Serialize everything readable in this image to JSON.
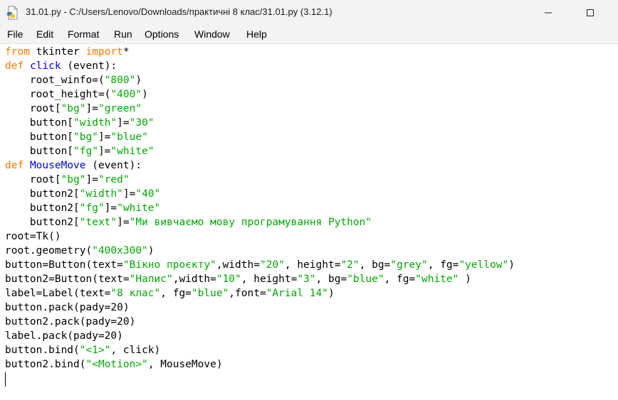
{
  "window": {
    "title": "31.01.py - C:/Users/Lenovo/Downloads/практичні 8 клас/31.01.py (3.12.1)"
  },
  "menu": [
    {
      "label": "File"
    },
    {
      "label": "Edit"
    },
    {
      "label": "Format"
    },
    {
      "label": "Run"
    },
    {
      "label": "Options"
    },
    {
      "label": "Window"
    },
    {
      "label": "Help"
    }
  ],
  "code": {
    "l1": {
      "a": "from",
      "b": " tkinter ",
      "c": "import",
      "d": "*"
    },
    "l2": {
      "a": "def",
      "b": " ",
      "c": "click",
      "d": " (event):"
    },
    "l3": {
      "a": "    root_winfo=(",
      "b": "\"800\"",
      "c": ")"
    },
    "l4": {
      "a": "    root_height=(",
      "b": "\"400\"",
      "c": ")"
    },
    "l5": {
      "a": "    root[",
      "b": "\"bg\"",
      "c": "]=",
      "d": "\"green\""
    },
    "l6": {
      "a": "    button[",
      "b": "\"width\"",
      "c": "]=",
      "d": "\"30\""
    },
    "l7": {
      "a": "    button[",
      "b": "\"bg\"",
      "c": "]=",
      "d": "\"blue\""
    },
    "l8": {
      "a": "    button[",
      "b": "\"fg\"",
      "c": "]=",
      "d": "\"white\""
    },
    "l9": {
      "a": "def",
      "b": " ",
      "c": "MouseMove",
      "d": " (event):"
    },
    "l10": {
      "a": "    root[",
      "b": "\"bg\"",
      "c": "]=",
      "d": "\"red\""
    },
    "l11": {
      "a": "    button2[",
      "b": "\"width\"",
      "c": "]=",
      "d": "\"40\""
    },
    "l12": {
      "a": "    button2[",
      "b": "\"fg\"",
      "c": "]=",
      "d": "\"white\""
    },
    "l13": {
      "a": "    button2[",
      "b": "\"text\"",
      "c": "]=",
      "d": "\"Ми вивчаємо мову програмування Python\""
    },
    "l14": {
      "a": "root=Tk()"
    },
    "l15": {
      "a": "root.geometry(",
      "b": "\"400x300\"",
      "c": ")"
    },
    "l16": {
      "a": "button=Button(text=",
      "b": "\"Вікно проєкту\"",
      "c": ",width=",
      "d": "\"20\"",
      "e": ", height=",
      "f": "\"2\"",
      "g": ", bg=",
      "h": "\"grey\"",
      "i": ", fg=",
      "j": "\"yellow\"",
      "k": ")"
    },
    "l17": {
      "a": "button2=Button(text=",
      "b": "\"Напис\"",
      "c": ",width=",
      "d": "\"10\"",
      "e": ", height=",
      "f": "\"3\"",
      "g": ", bg=",
      "h": "\"blue\"",
      "i": ", fg=",
      "j": "\"white\"",
      "k": " )"
    },
    "l18": {
      "a": "label=Label(text=",
      "b": "\"8 клас\"",
      "c": ", fg=",
      "d": "\"blue\"",
      "e": ",font=",
      "f": "\"Arial 14\"",
      "g": ")"
    },
    "l19": {
      "a": "button.pack(pady=20)"
    },
    "l20": {
      "a": "button2.pack(pady=20)"
    },
    "l21": {
      "a": "label.pack(pady=20)"
    },
    "l22": {
      "a": "button.bind(",
      "b": "\"<1>\"",
      "c": ", click)"
    },
    "l23": {
      "a": "button2.bind(",
      "b": "\"<Motion>\"",
      "c": ", MouseMove)"
    }
  },
  "colors": {
    "keyword": "#ff7700",
    "definition": "#0000ff",
    "string": "#00aa00",
    "chrome": "#f3f3f3"
  },
  "icons": {
    "app": "python-file-icon",
    "minimize": "minimize-icon",
    "maximize": "maximize-icon"
  }
}
